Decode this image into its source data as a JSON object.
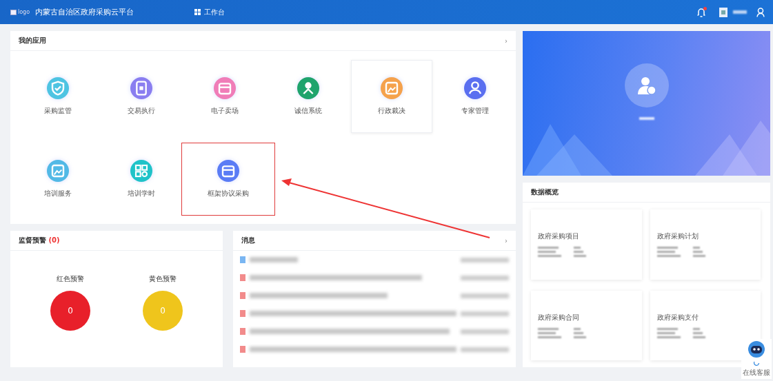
{
  "header": {
    "logo_alt": "logo",
    "title": "内蒙古自治区政府采购云平台",
    "nav_item": "工作台",
    "notification_dot": true
  },
  "apps_panel": {
    "title": "我的应用",
    "more": "›",
    "apps": [
      {
        "label": "采购监管",
        "kind": "shield",
        "color": "#4ec4e2",
        "hovered": false,
        "highlighted": false
      },
      {
        "label": "交易执行",
        "kind": "badge",
        "color": "#8a7ef0",
        "hovered": false,
        "highlighted": false
      },
      {
        "label": "电子卖场",
        "kind": "store",
        "color": "#f07db8",
        "hovered": false,
        "highlighted": false
      },
      {
        "label": "诚信系统",
        "kind": "network",
        "color": "#1fa46c",
        "hovered": false,
        "highlighted": false
      },
      {
        "label": "行政裁决",
        "kind": "picture",
        "color": "#f5a24c",
        "hovered": true,
        "highlighted": false
      },
      {
        "label": "专家管理",
        "kind": "user",
        "color": "#5a6ff0",
        "hovered": false,
        "highlighted": false
      },
      {
        "label": "培训服务",
        "kind": "picture",
        "color": "#52b9e6",
        "hovered": false,
        "highlighted": false
      },
      {
        "label": "培训学时",
        "kind": "grid",
        "color": "#20c3c8",
        "hovered": false,
        "highlighted": false
      },
      {
        "label": "框架协议采购",
        "kind": "store",
        "color": "#5a7cf5",
        "hovered": false,
        "highlighted": true
      }
    ]
  },
  "alerts_panel": {
    "title": "监督预警",
    "count": "(0)",
    "alerts": [
      {
        "label": "红色预警",
        "value": "0",
        "color": "#e8202a"
      },
      {
        "label": "黄色预警",
        "value": "0",
        "color": "#efc51c"
      }
    ]
  },
  "messages_panel": {
    "title": "消息",
    "more": "›",
    "messages": [
      {
        "color": "#7ab6f2"
      },
      {
        "color": "#f28b8b"
      },
      {
        "color": "#f28b8b"
      },
      {
        "color": "#f28b8b"
      },
      {
        "color": "#f28b8b"
      },
      {
        "color": "#f28b8b"
      }
    ]
  },
  "overview_panel": {
    "title": "数据概览",
    "cards": [
      {
        "title": "政府采购项目"
      },
      {
        "title": "政府采购计划"
      },
      {
        "title": "政府采购合同"
      },
      {
        "title": "政府采购支付"
      }
    ]
  },
  "support": {
    "label": "在线客服"
  }
}
